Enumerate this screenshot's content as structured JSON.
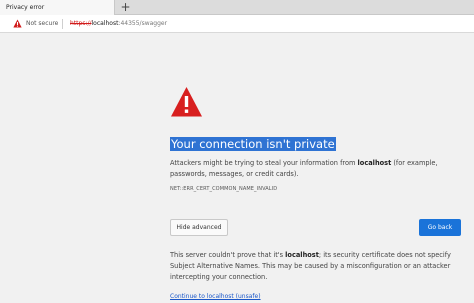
{
  "tab": {
    "title": "Privacy error",
    "new_tab_symbol": "+"
  },
  "address_bar": {
    "security_label": "Not secure",
    "url_scheme": "https://",
    "url_host": "localhost",
    "url_rest": ":44355/swagger"
  },
  "interstitial": {
    "icon": "warning-triangle-icon",
    "heading": "Your connection isn't private",
    "desc_before": "Attackers might be trying to steal your information from ",
    "desc_host": "localhost",
    "desc_after": " (for example, passwords, messages, or credit cards).",
    "error_code": "NET::ERR_CERT_COMMON_NAME_INVALID",
    "hide_advanced_label": "Hide advanced",
    "go_back_label": "Go back",
    "details_before": "This server couldn't prove that it's ",
    "details_host": "localhost",
    "details_after": "; its security certificate does not specify Subject Alternative Names. This may be caused by a misconfiguration or an attacker intercepting your connection.",
    "proceed_link": "Continue to localhost (unsafe)"
  },
  "colors": {
    "accent": "#1a73d9",
    "warning_red": "#d11a1a",
    "heading_highlight": "#2f73d3"
  }
}
